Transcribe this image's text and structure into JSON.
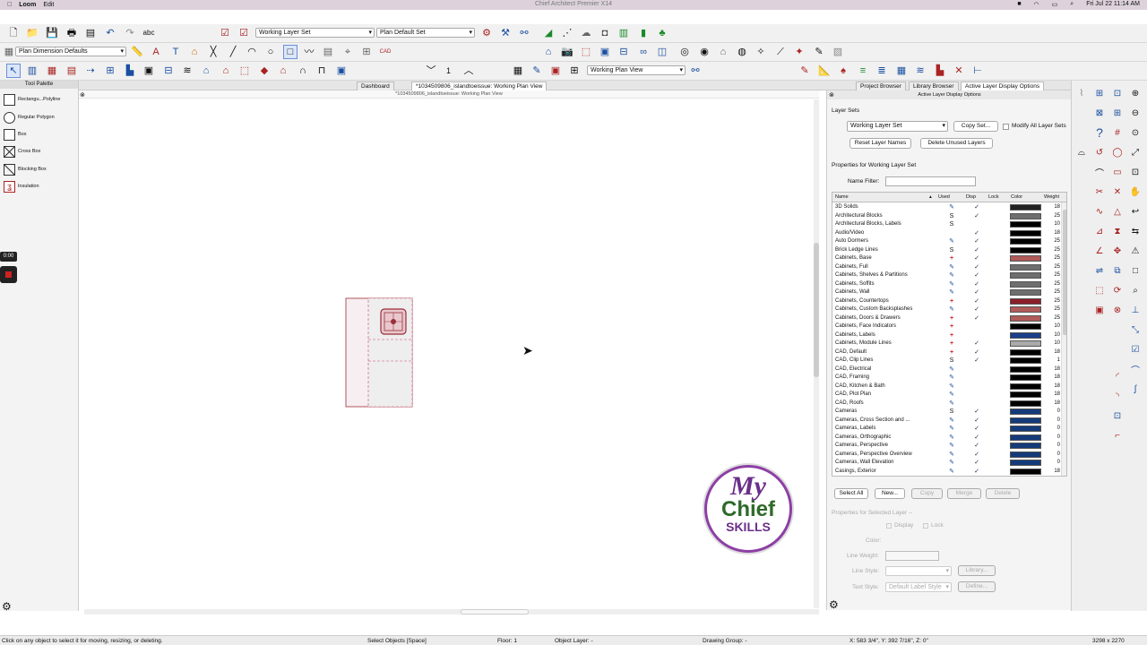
{
  "menubar": {
    "app": "Loom",
    "edit": "Edit",
    "clock": "Fri Jul 22  11:14 AM"
  },
  "window_title": "Chief Architect Premier X14",
  "toolbar1": {
    "layer_set": "Working Layer Set",
    "plan_set": "Plan Default Set"
  },
  "toolbar2": {
    "dim_defaults": "Plan Dimension Defaults"
  },
  "toolbar3": {
    "floor_value": "1",
    "view_select": "Working Plan View"
  },
  "tabs": {
    "dashboard": "Dashboard",
    "plan": "*1034509806_islandtoeissue:  Working Plan View",
    "project_browser": "Project Browser",
    "library_browser": "Library Browser",
    "active_layer": "Active Layer Display Options"
  },
  "palette": {
    "title": "Tool Palette",
    "items": [
      "Rectangu...Polyline",
      "Regular Polygon",
      "Box",
      "Cross Box",
      "Blocking Box",
      "Insulation"
    ],
    "timer": "0:00"
  },
  "canvas": {
    "title": "*1034509806_islandtoeissue:  Working Plan View"
  },
  "logo": {
    "line1": "My",
    "line2": "Chief",
    "line3": "SKILLS"
  },
  "panel": {
    "title": "Active Layer Display Options",
    "layer_sets_label": "Layer Sets",
    "layer_set_value": "Working Layer Set",
    "copy_set": "Copy Set...",
    "modify_all": "Modify All Layer Sets",
    "reset_names": "Reset Layer Names",
    "delete_unused": "Delete Unused Layers",
    "properties_for": "Properties for  Working Layer Set",
    "name_filter": "Name Filter:",
    "columns": [
      "Name",
      "Used",
      "Disp",
      "Lock",
      "Color",
      "Weight"
    ],
    "rows": [
      {
        "name": "3D Solids",
        "used": "pen",
        "disp": true,
        "color": "#222222",
        "weight": "18"
      },
      {
        "name": "Architectural Blocks",
        "used": "S",
        "disp": true,
        "color": "#6e6e6e",
        "weight": "25"
      },
      {
        "name": "Architectural Blocks, Labels",
        "used": "S",
        "disp": false,
        "color": "#000000",
        "weight": "10"
      },
      {
        "name": "Audio/Video",
        "used": "",
        "disp": true,
        "color": "#000000",
        "weight": "18"
      },
      {
        "name": "Auto Dormers",
        "used": "pen",
        "disp": true,
        "color": "#000000",
        "weight": "25"
      },
      {
        "name": "Brick Ledge Lines",
        "used": "S",
        "disp": true,
        "color": "#000000",
        "weight": "25"
      },
      {
        "name": "Cabinets,  Base",
        "used": "+",
        "disp": true,
        "color": "#b05a5a",
        "weight": "25"
      },
      {
        "name": "Cabinets,  Full",
        "used": "pen",
        "disp": true,
        "color": "#6e6e6e",
        "weight": "25"
      },
      {
        "name": "Cabinets,  Shelves & Partitions",
        "used": "pen",
        "disp": true,
        "color": "#6e6e6e",
        "weight": "25"
      },
      {
        "name": "Cabinets,  Soffits",
        "used": "pen",
        "disp": true,
        "color": "#6e6e6e",
        "weight": "25"
      },
      {
        "name": "Cabinets,  Wall",
        "used": "pen",
        "disp": true,
        "color": "#6e6e6e",
        "weight": "25"
      },
      {
        "name": "Cabinets, Countertops",
        "used": "+",
        "disp": true,
        "color": "#8a1e2a",
        "weight": "25"
      },
      {
        "name": "Cabinets, Custom Backsplashes",
        "used": "pen",
        "disp": true,
        "color": "#b05a5a",
        "weight": "25"
      },
      {
        "name": "Cabinets, Doors & Drawers",
        "used": "+",
        "disp": true,
        "color": "#b05a5a",
        "weight": "25"
      },
      {
        "name": "Cabinets, Face Indicators",
        "used": "+",
        "disp": false,
        "color": "#000000",
        "weight": "10"
      },
      {
        "name": "Cabinets, Labels",
        "used": "+",
        "disp": false,
        "color": "#1a3f8a",
        "weight": "10"
      },
      {
        "name": "Cabinets, Module Lines",
        "used": "+",
        "disp": true,
        "color": "#aaaaaa",
        "weight": "10"
      },
      {
        "name": "CAD,  Default",
        "used": "+",
        "disp": true,
        "color": "#000000",
        "weight": "18"
      },
      {
        "name": "CAD, Clip Lines",
        "used": "S",
        "disp": true,
        "color": "#000000",
        "weight": "1"
      },
      {
        "name": "CAD, Electrical",
        "used": "pen",
        "disp": false,
        "color": "#000000",
        "weight": "18"
      },
      {
        "name": "CAD, Framing",
        "used": "pen",
        "disp": false,
        "color": "#000000",
        "weight": "18"
      },
      {
        "name": "CAD, Kitchen & Bath",
        "used": "pen",
        "disp": false,
        "color": "#000000",
        "weight": "18"
      },
      {
        "name": "CAD, Plot Plan",
        "used": "pen",
        "disp": false,
        "color": "#000000",
        "weight": "18"
      },
      {
        "name": "CAD, Roofs",
        "used": "pen",
        "disp": false,
        "color": "#000000",
        "weight": "18"
      },
      {
        "name": "Cameras",
        "used": "S",
        "disp": true,
        "color": "#143a7a",
        "weight": "0"
      },
      {
        "name": "Cameras, Cross Section and ...",
        "used": "pen",
        "disp": true,
        "color": "#143a7a",
        "weight": "0"
      },
      {
        "name": "Cameras, Labels",
        "used": "pen",
        "disp": true,
        "color": "#143a7a",
        "weight": "0"
      },
      {
        "name": "Cameras, Orthographic",
        "used": "pen",
        "disp": true,
        "color": "#143a7a",
        "weight": "0"
      },
      {
        "name": "Cameras, Perspective",
        "used": "pen",
        "disp": true,
        "color": "#143a7a",
        "weight": "0"
      },
      {
        "name": "Cameras, Perspective Overview",
        "used": "pen",
        "disp": true,
        "color": "#143a7a",
        "weight": "0"
      },
      {
        "name": "Cameras, Wall Elevation",
        "used": "pen",
        "disp": true,
        "color": "#143a7a",
        "weight": "0"
      },
      {
        "name": "Casings, Exterior",
        "used": "pen",
        "disp": true,
        "color": "#000000",
        "weight": "18"
      }
    ],
    "buttons": {
      "select_all": "Select All",
      "new": "New...",
      "copy": "Copy",
      "merge": "Merge",
      "delete": "Delete"
    },
    "selected_props": "Properties for Selected Layer --",
    "display": "Display",
    "lock": "Lock",
    "color": "Color:",
    "line_weight": "Line Weight:",
    "line_style": "Line Style:",
    "library": "Library...",
    "text_style": "Text Style:",
    "text_style_value": "Default Label Style",
    "define": "Define..."
  },
  "status": {
    "hint": "Click on any object to select it for moving, resizing, or deleting.",
    "mode": "Select Objects [Space]",
    "floor": "Floor: 1",
    "object_layer": "Object Layer: -",
    "drawing_group": "Drawing Group: -",
    "coords": "X: 583 3/4\", Y: 392 7/16\", Z: 0\"",
    "size": "3298 x 2270"
  }
}
